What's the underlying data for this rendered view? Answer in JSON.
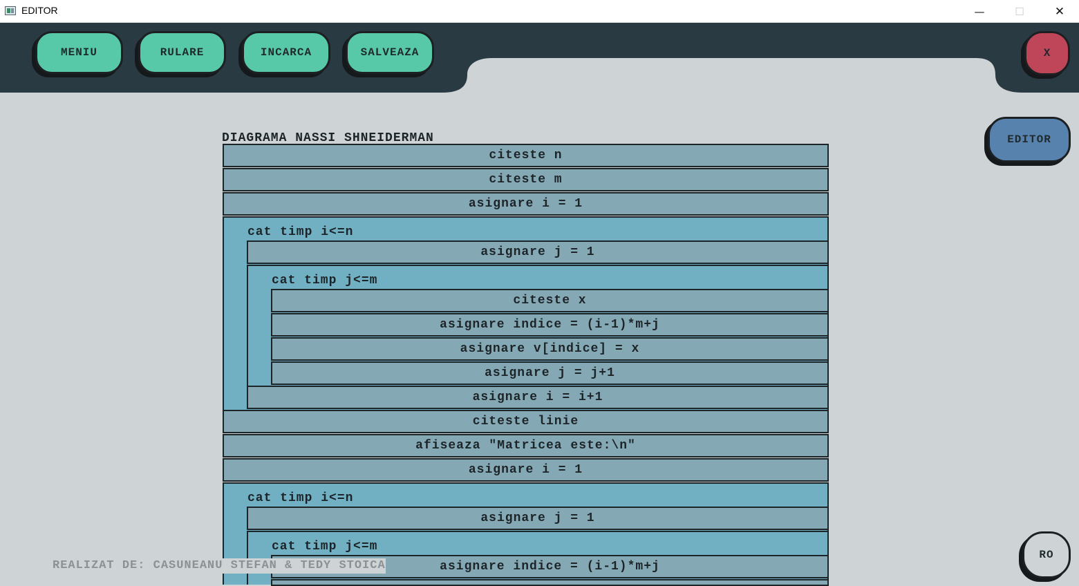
{
  "window": {
    "title": "EDITOR",
    "minimize": "—",
    "maximize": "☐",
    "close": "✕"
  },
  "toolbar": {
    "meniu": "MENIU",
    "rulare": "RULARE",
    "incarca": "INCARCA",
    "salveaza": "SALVEAZA",
    "close": "X"
  },
  "side": {
    "editor": "EDITOR",
    "lang": "RO"
  },
  "diagram": {
    "title": "DIAGRAMA NASSI SHNEIDERMAN",
    "s1": "citeste n",
    "s2": "citeste m",
    "s3": "asignare i = 1",
    "loop1": "cat timp i<=n",
    "s4": "asignare j = 1",
    "loop2": "cat timp j<=m",
    "s5": "citeste x",
    "s6": "asignare indice = (i-1)*m+j",
    "s7": "asignare v[indice] = x",
    "s8": "asignare j = j+1",
    "s9": "asignare i = i+1",
    "s10": "citeste linie",
    "s11": "afiseaza \"Matricea este:\\n\"",
    "s12": "asignare i = 1",
    "loop3": "cat timp i<=n",
    "s13": "asignare j = 1",
    "loop4": "cat timp j<=m",
    "s14": "asignare indice = (i-1)*m+j"
  },
  "footer": {
    "credits": "REALIZAT DE: CASUNEANU STEFAN & TEDY STOICA"
  },
  "colors": {
    "toolbar": "#293a43",
    "teal": "#57c9a8",
    "red": "#bf4659",
    "blue": "#5782ae",
    "block": "#85a8b5",
    "loop": "#71afc3",
    "background": "#ced4d6"
  }
}
